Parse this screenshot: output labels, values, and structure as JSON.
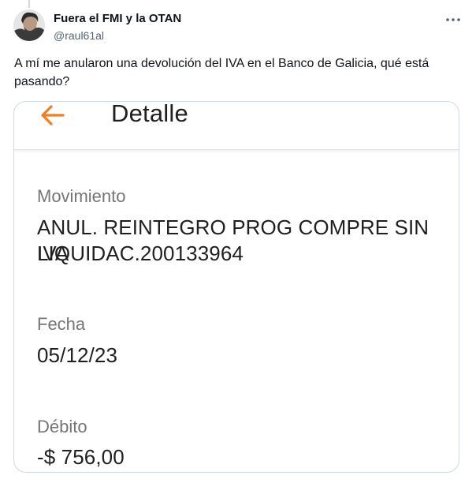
{
  "author": {
    "display_name": "Fuera el FMI y la OTAN",
    "handle": "@raul61al"
  },
  "tweet": {
    "text": "A mí me anularon una devolución del IVA en el Banco de Galicia, qué está pasando?"
  },
  "icons": {
    "more": "more-horizontal-icon",
    "back": "arrow-left-icon"
  },
  "colors": {
    "accent_orange": "#f07f22",
    "text_primary": "#0f1419",
    "text_secondary": "#536471"
  },
  "screenshot": {
    "header_title": "Detalle",
    "movimiento_label": "Movimiento",
    "movimiento_line1": "ANUL. REINTEGRO PROG COMPRE SIN IVA",
    "movimiento_line2": "LIQUIDAC.200133964",
    "fecha_label": "Fecha",
    "fecha_value": "05/12/23",
    "debito_label": "Débito",
    "debito_value": "-$ 756,00"
  }
}
